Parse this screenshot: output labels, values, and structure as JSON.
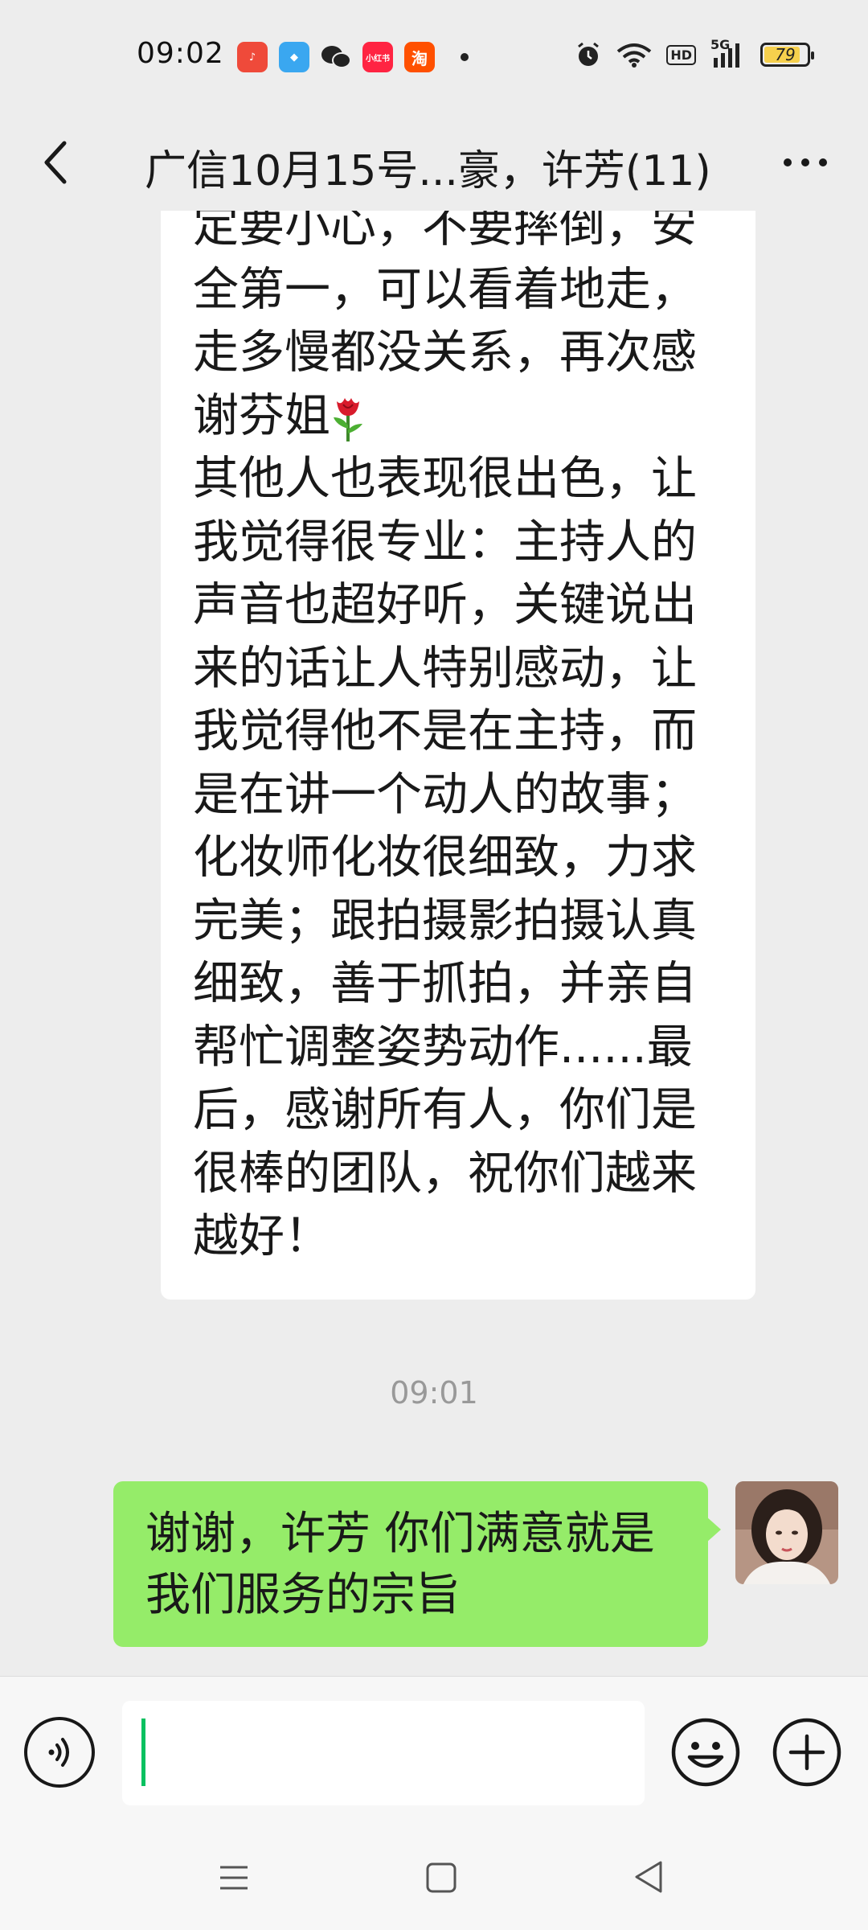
{
  "status_bar": {
    "time": "09:02",
    "app_icons": [
      {
        "name": "music-app-icon",
        "color": "#ef4a3a",
        "glyph": "♪"
      },
      {
        "name": "blue-app-icon",
        "color": "#3aa7f0",
        "glyph": "◆"
      },
      {
        "name": "wechat-app-icon",
        "color": "#2aae67",
        "glyph": ""
      },
      {
        "name": "red-book-app-icon",
        "color": "#ff2442",
        "glyph": "小红书"
      },
      {
        "name": "taobao-app-icon",
        "color": "#ff5000",
        "glyph": "淘"
      }
    ],
    "network": "5G",
    "hd_label": "HD",
    "battery_level": "79"
  },
  "header": {
    "title": "广信10月15号...豪，许芳(11)",
    "back_icon": "chevron-left-icon",
    "more_icon": "more-icon"
  },
  "messages": [
    {
      "direction": "incoming",
      "lines": [
        "定要小心，不要摔倒，安",
        "全第一，可以看着地走，",
        "走多慢都没关系，再次感",
        "谢芬姐",
        "其他人也表现很出色，让",
        "我觉得很专业：主持人的",
        "声音也超好听，关键说出",
        "来的话让人特别感动，让",
        "我觉得他不是在主持，而",
        "是在讲一个动人的故事；",
        "化妆师化妆很细致，力求",
        "完美；跟拍摄影拍摄认真",
        "细致，善于抓拍，并亲自",
        "帮忙调整姿势动作......最",
        "后，感谢所有人，你们是",
        "很棒的团队，祝你们越来",
        "越好！"
      ],
      "emoji_after_line": "rose-emoji"
    },
    {
      "type": "timestamp",
      "text": "09:01"
    },
    {
      "direction": "outgoing",
      "lines": [
        "谢谢，许芳 你们满意就是",
        "我们服务的宗旨"
      ]
    }
  ],
  "input_bar": {
    "input_value": "",
    "voice_icon": "voice-icon",
    "emoji_icon": "emoji-icon",
    "plus_icon": "plus-icon",
    "accent_color": "#07c160"
  },
  "colors": {
    "background": "#ededed",
    "incoming_bubble": "#ffffff",
    "outgoing_bubble": "#95ec69"
  }
}
